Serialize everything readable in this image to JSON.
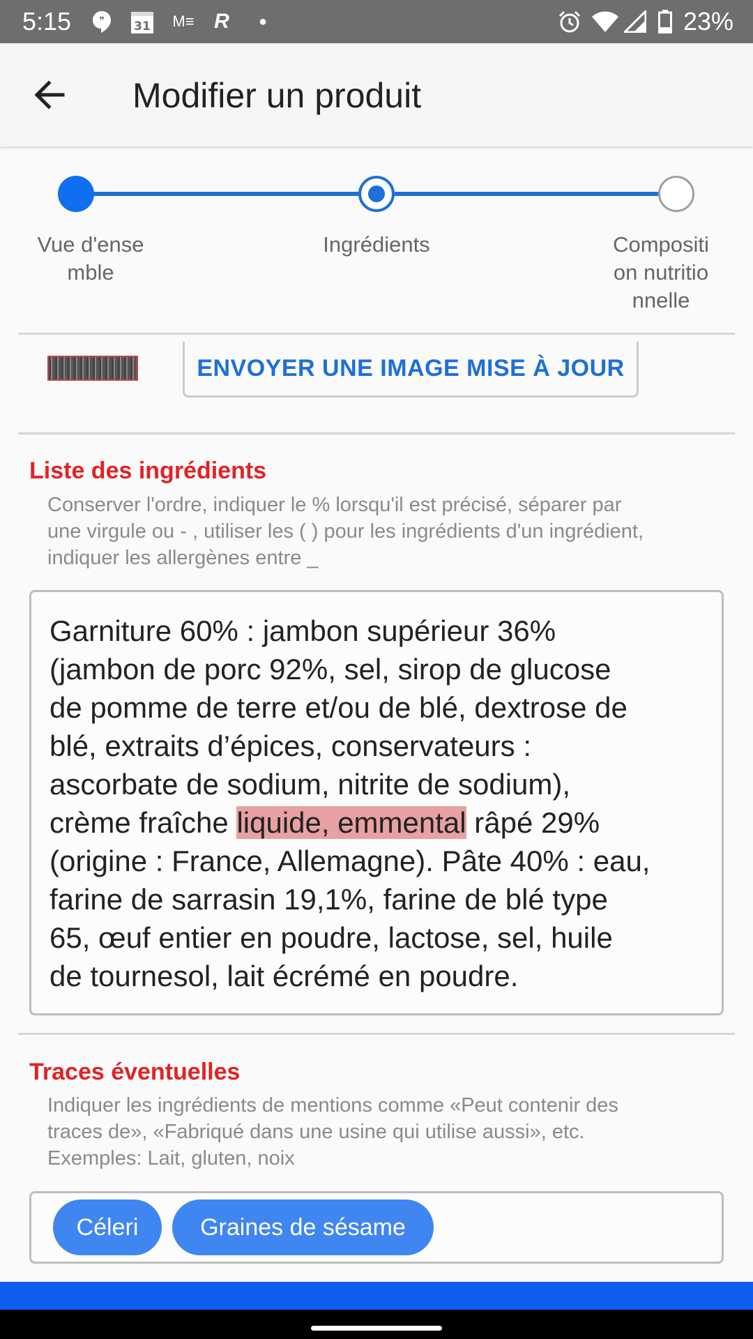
{
  "status_bar": {
    "time": "5:15",
    "battery": "23%",
    "icons": [
      "hangouts-icon",
      "calendar-icon",
      "gmail-icon",
      "r-app-icon",
      "dot-icon",
      "alarm-icon",
      "wifi-icon",
      "signal-icon",
      "battery-icon"
    ],
    "calendar_day": "31"
  },
  "app_bar": {
    "title": "Modifier un produit",
    "back_icon": "arrow-left-icon"
  },
  "stepper": {
    "accent_color": "#1e6fd9",
    "steps": [
      {
        "label_lines": [
          "Vue d'ense",
          "mble"
        ],
        "state": "completed"
      },
      {
        "label_lines": [
          "Ingrédients"
        ],
        "state": "current"
      },
      {
        "label_lines": [
          "Compositi",
          "on nutritio",
          "nnelle"
        ],
        "state": "pending"
      }
    ]
  },
  "upload_button": "ENVOYER UNE IMAGE MISE À JOUR",
  "ingredients": {
    "title": "Liste des ingrédients",
    "hint_lines": [
      "Conserver l'ordre, indiquer le % lorsqu'il est précisé, séparer par",
      "une virgule ou - , utiliser les ( ) pour les ingrédients d'un ingrédient,",
      "indiquer les allergènes entre _"
    ],
    "text_lines": [
      "Garniture 60% : jambon supérieur 36%",
      "(jambon de porc 92%, sel, sirop de glucose",
      "de pomme de terre et/ou de blé, dextrose de",
      "blé, extraits d’épices, conservateurs :",
      "ascorbate de sodium, nitrite de sodium),"
    ],
    "line6_before": "crème fraîche ",
    "line6_highlight": "liquide, emmental",
    "line6_after": " râpé 29%",
    "text_lines_end": [
      "(origine : France, Allemagne). Pâte 40% : eau,",
      "farine de sarrasin 19,1%, farine de blé type",
      "65, œuf entier en poudre, lactose, sel, huile",
      "de tournesol, lait écrémé en poudre."
    ],
    "highlight_color": "#e8a1a1"
  },
  "traces": {
    "title": "Traces éventuelles",
    "hint_lines": [
      "Indiquer les ingrédients de mentions comme «Peut contenir des",
      "traces de», «Fabriqué dans une usine qui utilise aussi», etc.",
      "Exemples: Lait, gluten, noix"
    ],
    "chips": [
      "Céleri",
      "Graines de sésame"
    ]
  },
  "colors": {
    "section_title": "#e02424",
    "chip": "#3f86f0",
    "bottom_bar": "#0f5ef0"
  }
}
